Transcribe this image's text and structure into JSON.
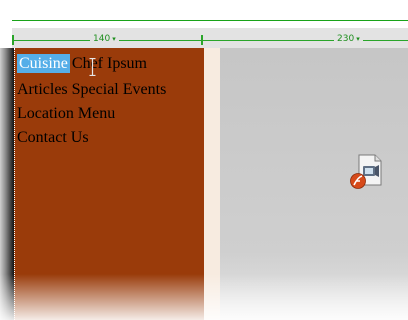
{
  "ruler": {
    "left_width": "140",
    "right_width": "230",
    "caret": "▾"
  },
  "nav": {
    "row1": {
      "selected": "Cuisine",
      "item": "Chef Ipsum"
    },
    "row2": {
      "item1": "Articles",
      "item2": "Special Events"
    },
    "row3": {
      "item1": "Location",
      "item2": "Menu"
    },
    "row4": {
      "item": "Contact Us"
    }
  },
  "icons": {
    "cursor": "text-cursor-icon",
    "plugin": "video-plugin-icon",
    "badge": "flash-badge-icon"
  },
  "colors": {
    "nav_background": "#9a3b0a",
    "selection": "#55aee8",
    "guide": "#2aa52a"
  }
}
